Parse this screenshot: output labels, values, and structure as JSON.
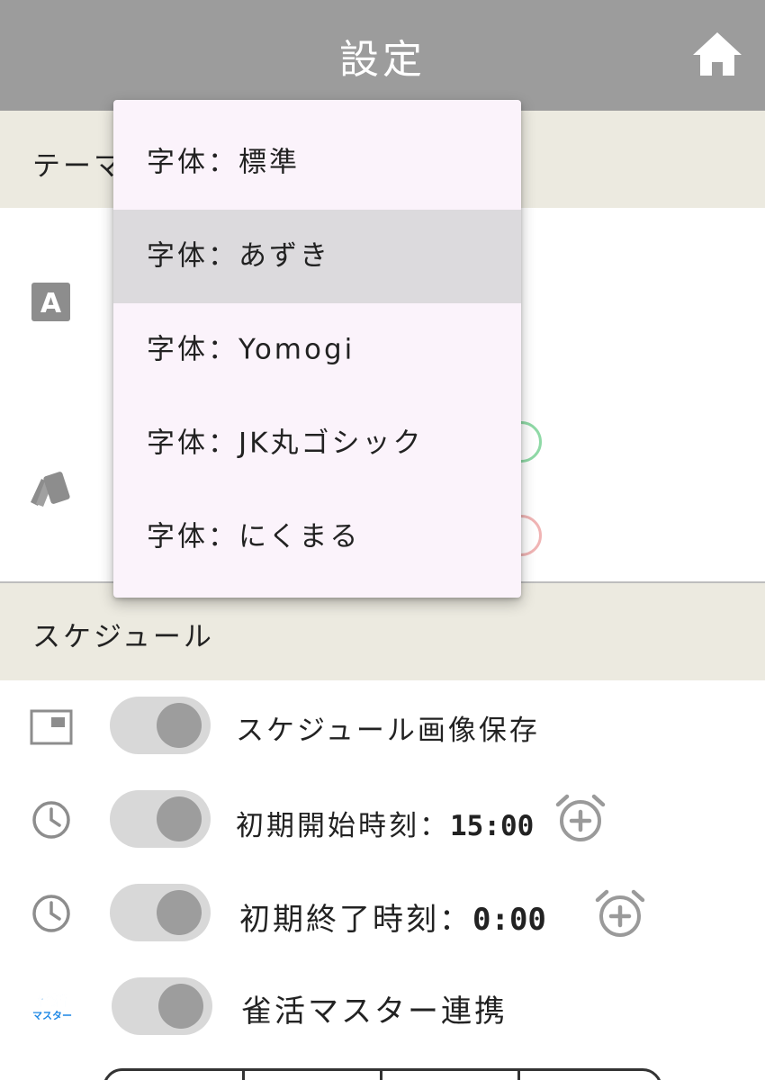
{
  "header": {
    "title": "設定",
    "home_icon": "home-icon"
  },
  "sections": {
    "theme": {
      "label": "テーマ"
    },
    "schedule": {
      "label": "スケジュール"
    }
  },
  "theme_rows": {
    "font_icon": "font-a-icon",
    "color_icon": "swatch-icon",
    "radio_colors": {
      "green": "#8fd9a6",
      "pink": "#f0b4b4"
    }
  },
  "font_menu": {
    "items": [
      {
        "label": "字体：標準"
      },
      {
        "label": "字体：あずき",
        "selected": true
      },
      {
        "label": "字体：Yomogi"
      },
      {
        "label": "字体：JK丸ゴシック"
      },
      {
        "label": "字体：にくまる"
      }
    ]
  },
  "schedule_rows": {
    "image_save": {
      "label": "スケジュール画像保存",
      "icon": "image-icon"
    },
    "start_time": {
      "label": "初期開始時刻：",
      "value": "15:00",
      "icon": "clock-icon",
      "action_icon": "alarm-add-icon"
    },
    "end_time": {
      "label": "初期終了時刻：",
      "value": "0:00",
      "icon": "clock-icon",
      "action_icon": "alarm-add-icon"
    },
    "jankatsu": {
      "label": "雀活マスター連携",
      "logo_line1": "雀活",
      "logo_line2": "マスター"
    }
  },
  "colors": {
    "appbar": "#9c9c9c",
    "section_bg": "#eceae0",
    "menu_bg": "#fbf3fb",
    "menu_selected": "#dcdadd",
    "toggle_track": "#d8d8d8",
    "toggle_knob": "#9d9d9d",
    "logo_blue": "#1e88e5"
  }
}
